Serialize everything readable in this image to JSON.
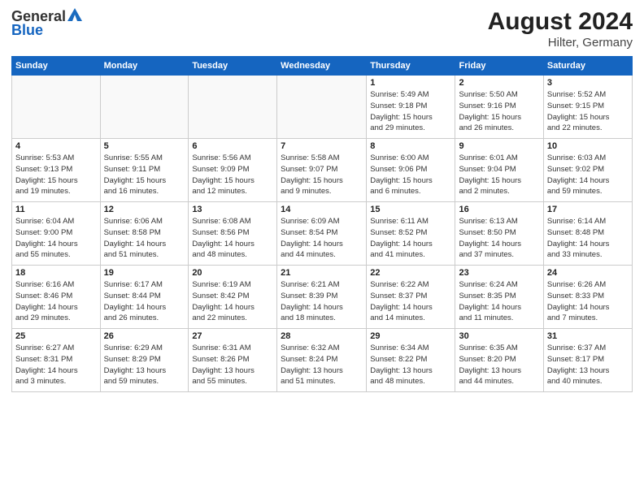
{
  "header": {
    "logo_line1": "General",
    "logo_line2": "Blue",
    "month_year": "August 2024",
    "location": "Hilter, Germany"
  },
  "days_of_week": [
    "Sunday",
    "Monday",
    "Tuesday",
    "Wednesday",
    "Thursday",
    "Friday",
    "Saturday"
  ],
  "weeks": [
    [
      {
        "day": "",
        "info": ""
      },
      {
        "day": "",
        "info": ""
      },
      {
        "day": "",
        "info": ""
      },
      {
        "day": "",
        "info": ""
      },
      {
        "day": "1",
        "info": "Sunrise: 5:49 AM\nSunset: 9:18 PM\nDaylight: 15 hours\nand 29 minutes."
      },
      {
        "day": "2",
        "info": "Sunrise: 5:50 AM\nSunset: 9:16 PM\nDaylight: 15 hours\nand 26 minutes."
      },
      {
        "day": "3",
        "info": "Sunrise: 5:52 AM\nSunset: 9:15 PM\nDaylight: 15 hours\nand 22 minutes."
      }
    ],
    [
      {
        "day": "4",
        "info": "Sunrise: 5:53 AM\nSunset: 9:13 PM\nDaylight: 15 hours\nand 19 minutes."
      },
      {
        "day": "5",
        "info": "Sunrise: 5:55 AM\nSunset: 9:11 PM\nDaylight: 15 hours\nand 16 minutes."
      },
      {
        "day": "6",
        "info": "Sunrise: 5:56 AM\nSunset: 9:09 PM\nDaylight: 15 hours\nand 12 minutes."
      },
      {
        "day": "7",
        "info": "Sunrise: 5:58 AM\nSunset: 9:07 PM\nDaylight: 15 hours\nand 9 minutes."
      },
      {
        "day": "8",
        "info": "Sunrise: 6:00 AM\nSunset: 9:06 PM\nDaylight: 15 hours\nand 6 minutes."
      },
      {
        "day": "9",
        "info": "Sunrise: 6:01 AM\nSunset: 9:04 PM\nDaylight: 15 hours\nand 2 minutes."
      },
      {
        "day": "10",
        "info": "Sunrise: 6:03 AM\nSunset: 9:02 PM\nDaylight: 14 hours\nand 59 minutes."
      }
    ],
    [
      {
        "day": "11",
        "info": "Sunrise: 6:04 AM\nSunset: 9:00 PM\nDaylight: 14 hours\nand 55 minutes."
      },
      {
        "day": "12",
        "info": "Sunrise: 6:06 AM\nSunset: 8:58 PM\nDaylight: 14 hours\nand 51 minutes."
      },
      {
        "day": "13",
        "info": "Sunrise: 6:08 AM\nSunset: 8:56 PM\nDaylight: 14 hours\nand 48 minutes."
      },
      {
        "day": "14",
        "info": "Sunrise: 6:09 AM\nSunset: 8:54 PM\nDaylight: 14 hours\nand 44 minutes."
      },
      {
        "day": "15",
        "info": "Sunrise: 6:11 AM\nSunset: 8:52 PM\nDaylight: 14 hours\nand 41 minutes."
      },
      {
        "day": "16",
        "info": "Sunrise: 6:13 AM\nSunset: 8:50 PM\nDaylight: 14 hours\nand 37 minutes."
      },
      {
        "day": "17",
        "info": "Sunrise: 6:14 AM\nSunset: 8:48 PM\nDaylight: 14 hours\nand 33 minutes."
      }
    ],
    [
      {
        "day": "18",
        "info": "Sunrise: 6:16 AM\nSunset: 8:46 PM\nDaylight: 14 hours\nand 29 minutes."
      },
      {
        "day": "19",
        "info": "Sunrise: 6:17 AM\nSunset: 8:44 PM\nDaylight: 14 hours\nand 26 minutes."
      },
      {
        "day": "20",
        "info": "Sunrise: 6:19 AM\nSunset: 8:42 PM\nDaylight: 14 hours\nand 22 minutes."
      },
      {
        "day": "21",
        "info": "Sunrise: 6:21 AM\nSunset: 8:39 PM\nDaylight: 14 hours\nand 18 minutes."
      },
      {
        "day": "22",
        "info": "Sunrise: 6:22 AM\nSunset: 8:37 PM\nDaylight: 14 hours\nand 14 minutes."
      },
      {
        "day": "23",
        "info": "Sunrise: 6:24 AM\nSunset: 8:35 PM\nDaylight: 14 hours\nand 11 minutes."
      },
      {
        "day": "24",
        "info": "Sunrise: 6:26 AM\nSunset: 8:33 PM\nDaylight: 14 hours\nand 7 minutes."
      }
    ],
    [
      {
        "day": "25",
        "info": "Sunrise: 6:27 AM\nSunset: 8:31 PM\nDaylight: 14 hours\nand 3 minutes."
      },
      {
        "day": "26",
        "info": "Sunrise: 6:29 AM\nSunset: 8:29 PM\nDaylight: 13 hours\nand 59 minutes."
      },
      {
        "day": "27",
        "info": "Sunrise: 6:31 AM\nSunset: 8:26 PM\nDaylight: 13 hours\nand 55 minutes."
      },
      {
        "day": "28",
        "info": "Sunrise: 6:32 AM\nSunset: 8:24 PM\nDaylight: 13 hours\nand 51 minutes."
      },
      {
        "day": "29",
        "info": "Sunrise: 6:34 AM\nSunset: 8:22 PM\nDaylight: 13 hours\nand 48 minutes."
      },
      {
        "day": "30",
        "info": "Sunrise: 6:35 AM\nSunset: 8:20 PM\nDaylight: 13 hours\nand 44 minutes."
      },
      {
        "day": "31",
        "info": "Sunrise: 6:37 AM\nSunset: 8:17 PM\nDaylight: 13 hours\nand 40 minutes."
      }
    ]
  ]
}
